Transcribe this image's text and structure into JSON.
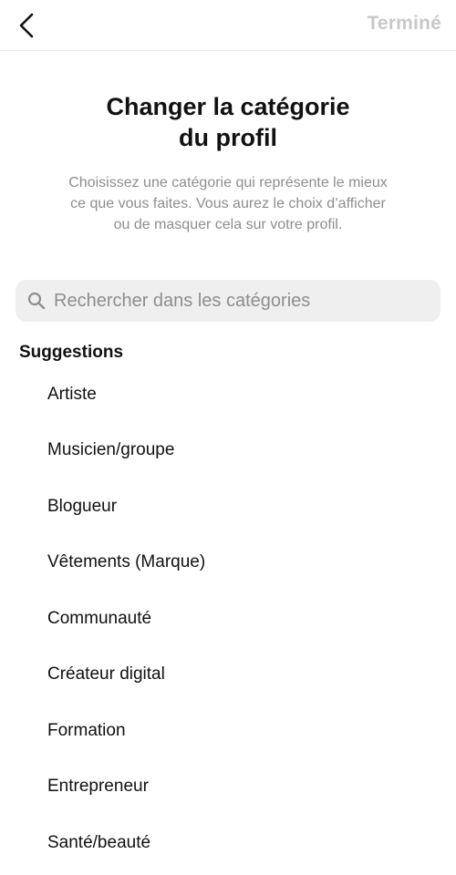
{
  "header": {
    "done_label": "Terminé"
  },
  "content": {
    "title_line1": "Changer la catégorie",
    "title_line2": "du profil",
    "description_line1": "Choisissez une catégorie qui représente le mieux",
    "description_line2": "ce que vous faites. Vous aurez le choix d’afficher",
    "description_line3": "ou de masquer cela sur votre profil."
  },
  "search": {
    "placeholder": "Rechercher dans les catégories",
    "value": ""
  },
  "suggestions": {
    "heading": "Suggestions",
    "items": [
      {
        "label": "Artiste"
      },
      {
        "label": "Musicien/groupe"
      },
      {
        "label": "Blogueur"
      },
      {
        "label": "Vêtements (Marque)"
      },
      {
        "label": "Communauté"
      },
      {
        "label": "Créateur digital"
      },
      {
        "label": "Formation"
      },
      {
        "label": "Entrepreneur"
      },
      {
        "label": "Santé/beauté"
      }
    ]
  },
  "icons": {
    "back": "chevron-left-icon",
    "search": "search-icon"
  },
  "colors": {
    "text_primary": "#111111",
    "text_secondary": "#8e8e8e",
    "done_disabled": "#c8c8c8",
    "search_background": "#efefef",
    "divider": "#e8e8e8"
  }
}
